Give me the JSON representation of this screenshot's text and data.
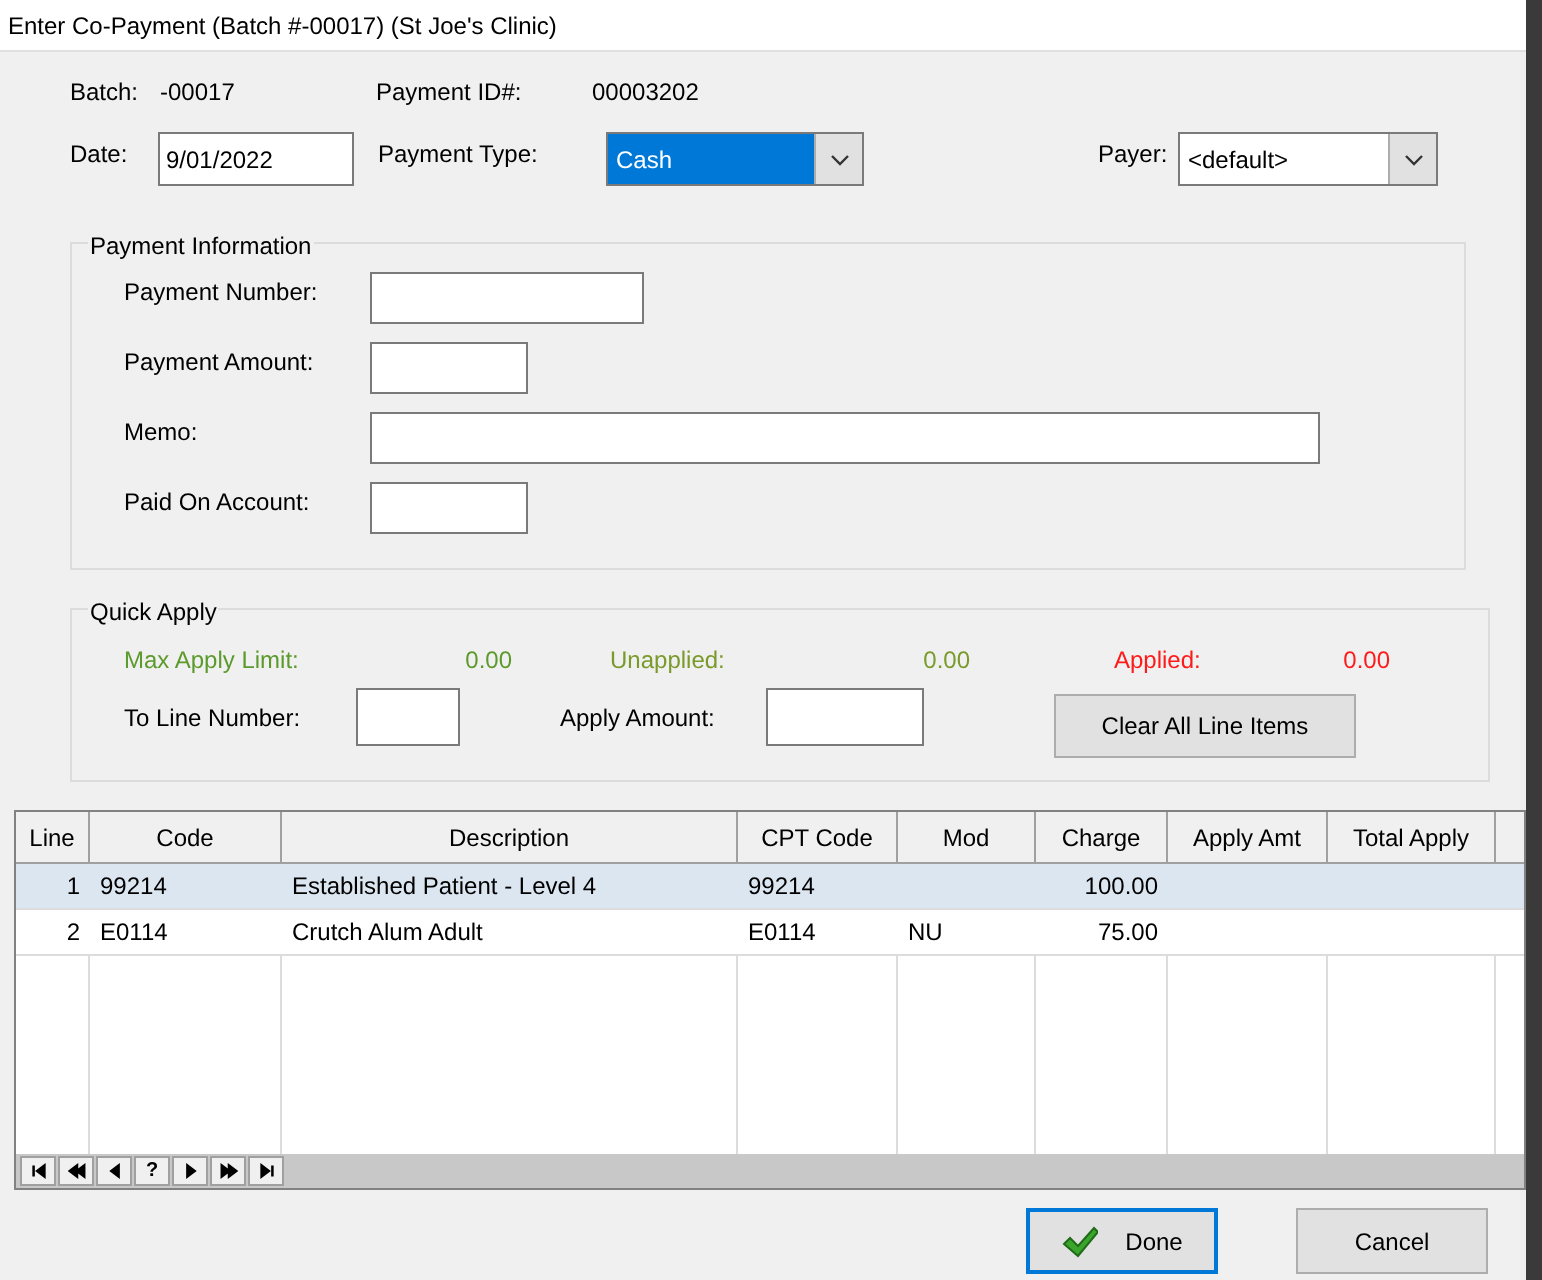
{
  "window": {
    "title": "Enter Co-Payment (Batch #-00017) (St Joe's Clinic)"
  },
  "header": {
    "batch_label": "Batch:",
    "batch": "-00017",
    "payment_id_label": "Payment ID#:",
    "payment_id": "00003202",
    "date_label": "Date:",
    "date": "9/01/2022",
    "payment_type_label": "Payment Type:",
    "payment_type": {
      "value": "Cash",
      "selected": true
    },
    "payer_label": "Payer:",
    "payer": {
      "value": "<default>",
      "selected": false
    }
  },
  "payment_information": {
    "title": "Payment Information",
    "fields": [
      {
        "label": "Payment Number:"
      },
      {
        "label": "Payment Amount:"
      },
      {
        "label": "Memo:"
      },
      {
        "label": "Paid On Account:"
      }
    ]
  },
  "quick_apply": {
    "title": "Quick Apply",
    "totals": [
      {
        "label": "Max Apply Limit:",
        "value": "0.00",
        "color": "#5b9a2b"
      },
      {
        "label": "Unapplied:",
        "value": "0.00",
        "color": "#7a9a2b"
      },
      {
        "label": "Applied:",
        "value": "0.00",
        "color": "#ff1a1a"
      }
    ],
    "to_line_label": "To Line Number:",
    "apply_amount_label": "Apply Amount:",
    "clear_button": "Clear All Line Items"
  },
  "table": {
    "columns": [
      "Line",
      "Code",
      "Description",
      "CPT Code",
      "Mod",
      "Charge",
      "Apply Amt",
      "Total Apply"
    ],
    "rows": [
      {
        "cells": [
          "1",
          "99214",
          "Established Patient - Level 4",
          "99214",
          "",
          "100.00",
          "",
          ""
        ],
        "selected": true
      },
      {
        "cells": [
          "2",
          "E0114",
          "Crutch Alum Adult",
          "E0114",
          "NU",
          "75.00",
          "",
          ""
        ],
        "selected": false
      }
    ],
    "navigator": [
      {
        "kind": "first"
      },
      {
        "kind": "prior-page"
      },
      {
        "kind": "prior"
      },
      {
        "kind": "help",
        "label": "?"
      },
      {
        "kind": "next"
      },
      {
        "kind": "next-page"
      },
      {
        "kind": "last"
      }
    ]
  },
  "buttons": [
    {
      "label": "Done",
      "kind": "default"
    },
    {
      "label": "Cancel",
      "kind": "normal"
    }
  ]
}
